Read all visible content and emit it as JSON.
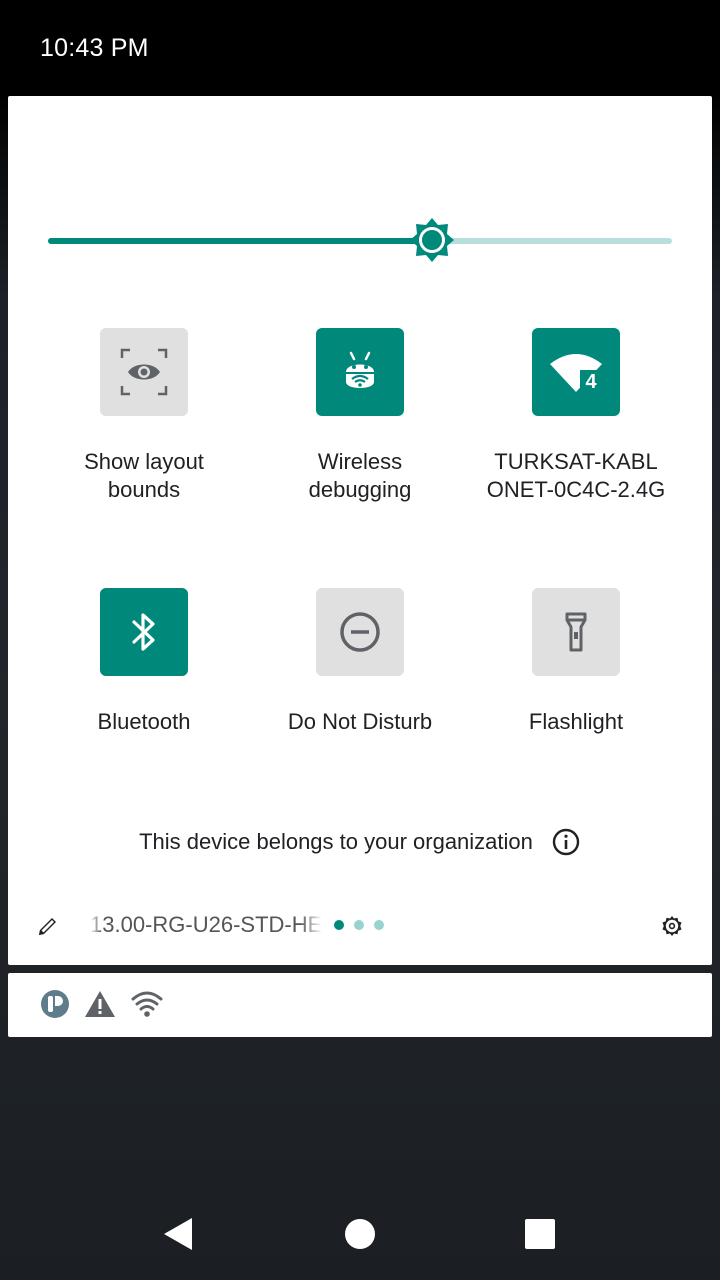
{
  "status_bar": {
    "time": "10:43 PM"
  },
  "brightness": {
    "level": 0.615
  },
  "tiles": [
    {
      "label": "Show layout\nbounds",
      "active": false,
      "icon": "layout-bounds-icon"
    },
    {
      "label": "Wireless\ndebugging",
      "active": true,
      "icon": "android-debug-icon"
    },
    {
      "label": "TURKSAT-KABL\nONET-0C4C-2.4G",
      "active": true,
      "icon": "wifi-icon"
    },
    {
      "label": "Bluetooth",
      "active": true,
      "icon": "bluetooth-icon"
    },
    {
      "label": "Do Not Disturb",
      "active": false,
      "icon": "do-not-disturb-icon"
    },
    {
      "label": "Flashlight",
      "active": false,
      "icon": "flashlight-icon"
    }
  ],
  "wifi_badge": "4",
  "organization_notice": "This device belongs to your organization",
  "footer": {
    "build_number": "13.00-RG-U26-STD-HE",
    "pages": 3,
    "current_page": 1
  },
  "notification_icons": [
    "app-icon",
    "warning-icon",
    "wifi-icon"
  ],
  "colors": {
    "accent": "#00897b",
    "accent_light": "#b9dfdc",
    "tile_off": "#e0e0e0"
  }
}
